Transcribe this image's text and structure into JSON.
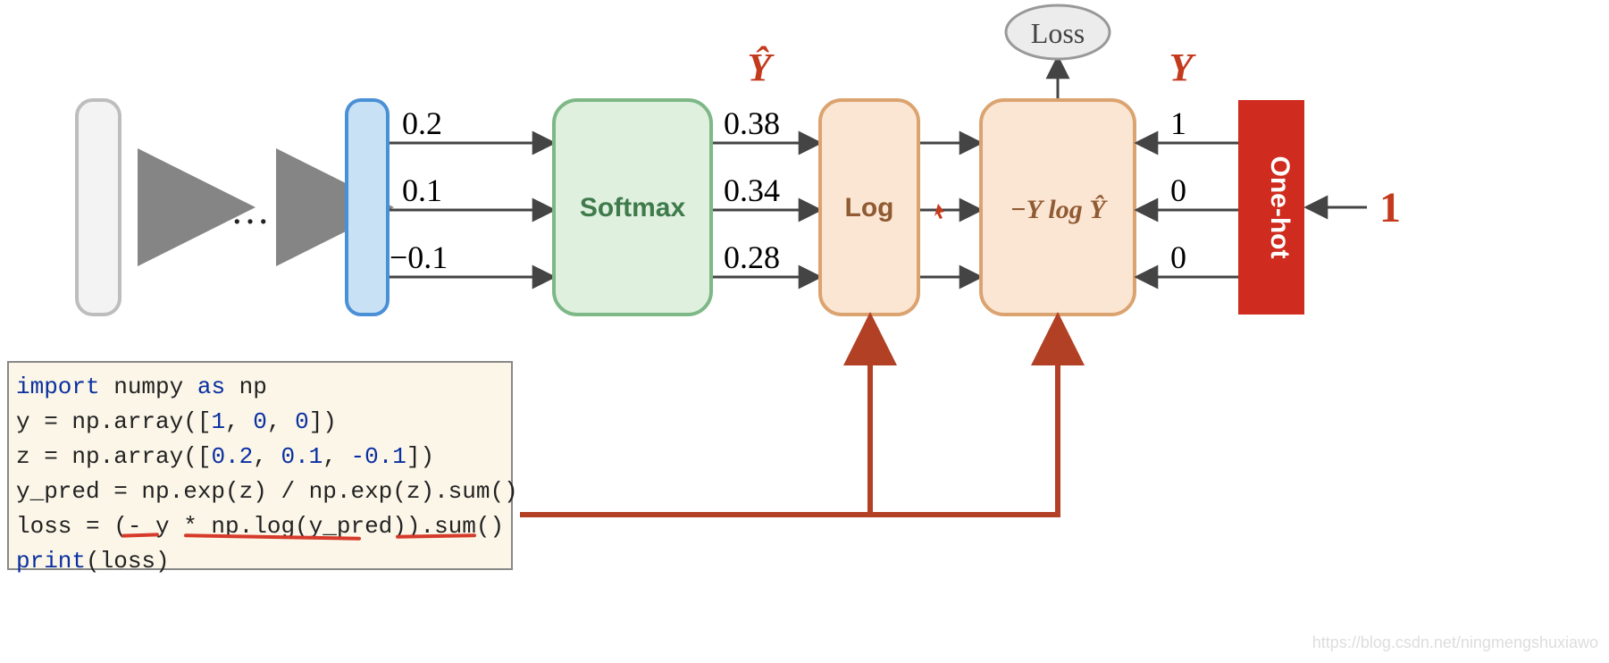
{
  "labels": {
    "ellipsis": "…",
    "yhat": "Ŷ",
    "y": "Y",
    "softmax": "Softmax",
    "log": "Log",
    "ylogy": "−Y log Ŷ",
    "loss": "Loss",
    "onehot": "One-hot",
    "input_one": "1"
  },
  "logits": [
    "0.2",
    "0.1",
    "−0.1"
  ],
  "probs": [
    "0.38",
    "0.34",
    "0.28"
  ],
  "target": [
    "1",
    "0",
    "0"
  ],
  "code": {
    "l1a": "import",
    "l1b": " numpy ",
    "l1c": "as",
    "l1d": " np",
    "l2a": "y = np.array([",
    "l2b": "1",
    "l2c": ", ",
    "l2d": "0",
    "l2e": ", ",
    "l2f": "0",
    "l2g": "])",
    "l3a": "z = np.array([",
    "l3b": "0.2",
    "l3c": ", ",
    "l3d": "0.1",
    "l3e": ", ",
    "l3f": "-0.1",
    "l3g": "])",
    "l4": "y_pred = np.exp(z) / np.exp(z).sum()",
    "l5": "loss = (- y * np.log(y_pred)).sum()",
    "l6a": "print",
    "l6b": "(loss)"
  },
  "watermark": "https://blog.csdn.net/ningmengshuxiawo"
}
